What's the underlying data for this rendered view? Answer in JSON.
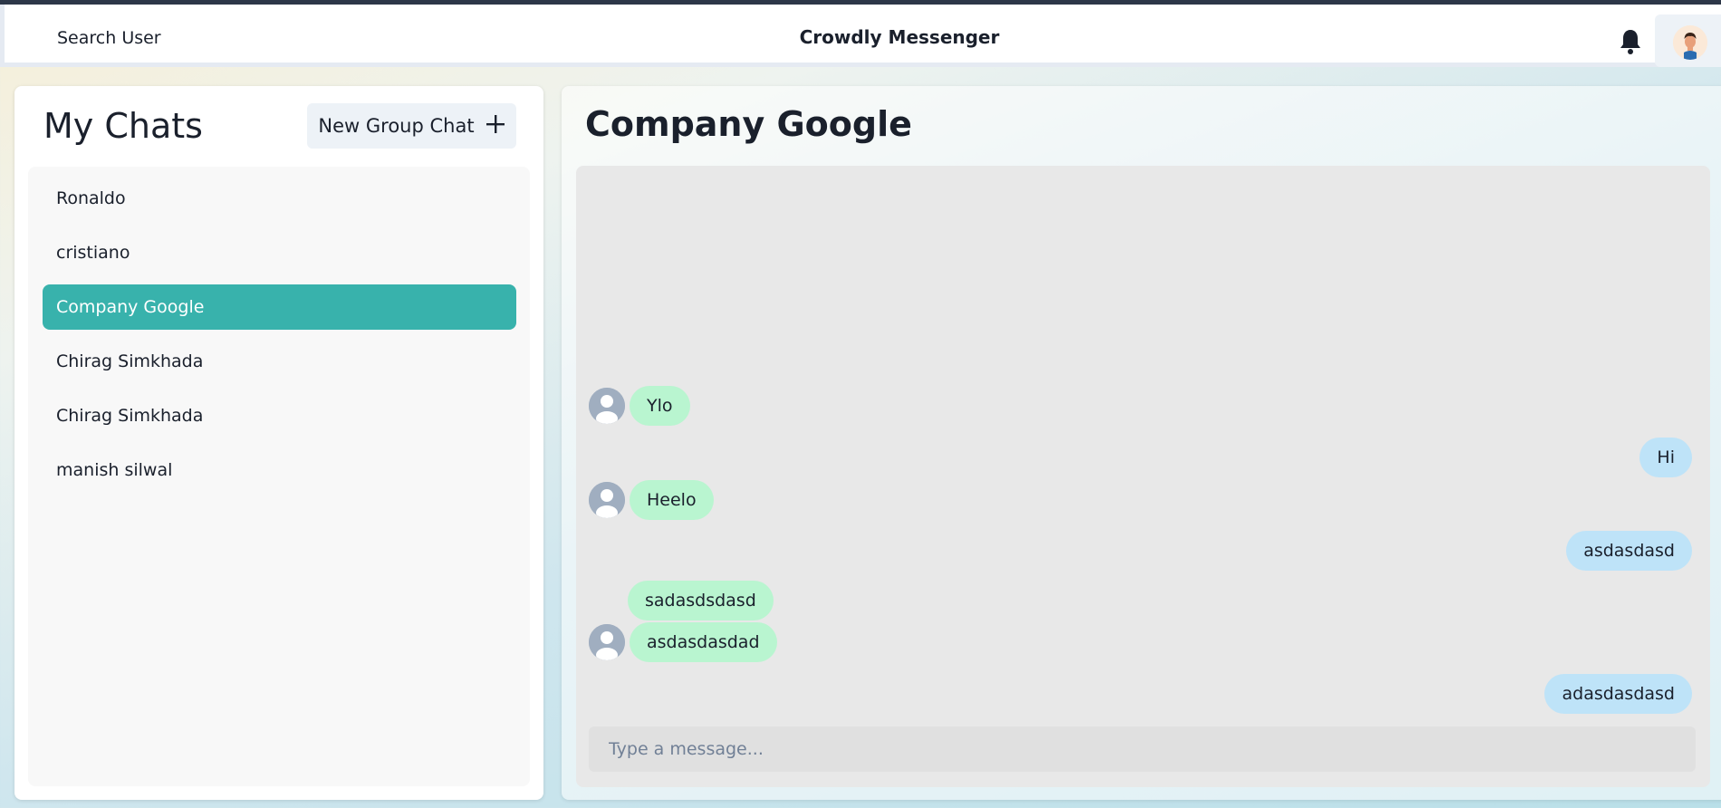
{
  "header": {
    "search_label": "Search User",
    "app_title": "Crowdly Messenger",
    "bell_icon": "bell-icon",
    "avatar_icon": "user-avatar"
  },
  "sidebar": {
    "title": "My Chats",
    "new_group_label": "New Group Chat",
    "new_group_icon": "plus-icon",
    "chats": [
      {
        "label": "Ronaldo",
        "active": false
      },
      {
        "label": "cristiano",
        "active": false
      },
      {
        "label": "Company Google",
        "active": true
      },
      {
        "label": "Chirag Simkhada",
        "active": false
      },
      {
        "label": "Chirag Simkhada",
        "active": false
      },
      {
        "label": "manish silwal",
        "active": false
      }
    ]
  },
  "chat": {
    "title": "Company Google",
    "messages": [
      {
        "text": "Ylo",
        "direction": "incoming",
        "show_avatar": true
      },
      {
        "text": "Hi",
        "direction": "outgoing",
        "show_avatar": false
      },
      {
        "text": "Heelo",
        "direction": "incoming",
        "show_avatar": true
      },
      {
        "text": "asdasdasd",
        "direction": "outgoing",
        "show_avatar": false
      },
      {
        "text": "sadasdsdasd",
        "direction": "incoming",
        "show_avatar": false
      },
      {
        "text": "asdasdasdad",
        "direction": "incoming",
        "show_avatar": true
      },
      {
        "text": "adasdasdasd",
        "direction": "outgoing",
        "show_avatar": false
      }
    ],
    "input_placeholder": "Type a message..."
  },
  "colors": {
    "active_chat": "#38b2ac",
    "incoming_bubble": "#b9f5d0",
    "outgoing_bubble": "#bee3f8"
  }
}
